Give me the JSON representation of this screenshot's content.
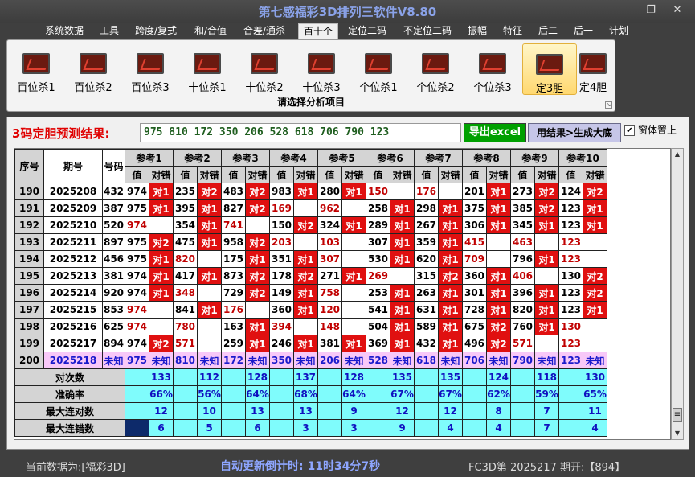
{
  "window": {
    "title": "第七感福彩3D排列三软件V8.80",
    "min": "—",
    "restore": "❐",
    "close": "✕"
  },
  "menu": [
    "系统数据",
    "工具",
    "跨度/复式",
    "和/合值",
    "合差/通杀",
    "百十个",
    "定位二码",
    "不定位二码",
    "振幅",
    "特征",
    "后二",
    "后一",
    "计划"
  ],
  "menu_active": "百十个",
  "ribbon": {
    "buttons": [
      "百位杀1",
      "百位杀2",
      "百位杀3",
      "十位杀1",
      "十位杀2",
      "十位杀3",
      "个位杀1",
      "个位杀2",
      "个位杀3",
      "定3胆",
      "定4胆"
    ],
    "selected": "定3胆",
    "caption": "请选择分析项目"
  },
  "prediction": {
    "label": "3码定胆预测结果:",
    "value": "975 810 172 350 206 528 618 706 790 123",
    "export_button": "导出excel",
    "generate_button": "用结果>生成大底",
    "topmost_label": "窗体置上",
    "topmost_checked": "✔"
  },
  "table": {
    "headers": {
      "index": "序号",
      "period": "期号",
      "number": "号码",
      "value": "值",
      "result": "对错"
    },
    "refs": [
      "参考1",
      "参考2",
      "参考3",
      "参考4",
      "参考5",
      "参考6",
      "参考7",
      "参考8",
      "参考9",
      "参考10"
    ],
    "rows": [
      {
        "idx": "190",
        "period": "2025208",
        "num": "432",
        "cells": [
          [
            "974",
            "对1"
          ],
          [
            "235",
            "对2"
          ],
          [
            "483",
            "对2"
          ],
          [
            "983",
            "对1"
          ],
          [
            "280",
            "对1"
          ],
          [
            "150",
            ""
          ],
          [
            "176",
            ""
          ],
          [
            "201",
            "对1"
          ],
          [
            "273",
            "对2"
          ],
          [
            "124",
            "对2"
          ]
        ]
      },
      {
        "idx": "191",
        "period": "2025209",
        "num": "387",
        "cells": [
          [
            "975",
            "对1"
          ],
          [
            "395",
            "对1"
          ],
          [
            "827",
            "对2"
          ],
          [
            "169",
            ""
          ],
          [
            "962",
            ""
          ],
          [
            "258",
            "对1"
          ],
          [
            "298",
            "对1"
          ],
          [
            "375",
            "对1"
          ],
          [
            "385",
            "对2"
          ],
          [
            "123",
            "对1"
          ]
        ]
      },
      {
        "idx": "192",
        "period": "2025210",
        "num": "520",
        "cells": [
          [
            "974",
            ""
          ],
          [
            "354",
            "对1"
          ],
          [
            "741",
            ""
          ],
          [
            "150",
            "对2"
          ],
          [
            "324",
            "对1"
          ],
          [
            "289",
            "对1"
          ],
          [
            "267",
            "对1"
          ],
          [
            "306",
            "对1"
          ],
          [
            "345",
            "对1"
          ],
          [
            "123",
            "对1"
          ]
        ]
      },
      {
        "idx": "193",
        "period": "2025211",
        "num": "897",
        "cells": [
          [
            "975",
            "对2"
          ],
          [
            "475",
            "对1"
          ],
          [
            "958",
            "对2"
          ],
          [
            "203",
            ""
          ],
          [
            "103",
            ""
          ],
          [
            "307",
            "对1"
          ],
          [
            "359",
            "对1"
          ],
          [
            "415",
            ""
          ],
          [
            "463",
            ""
          ],
          [
            "123",
            ""
          ]
        ]
      },
      {
        "idx": "194",
        "period": "2025212",
        "num": "456",
        "cells": [
          [
            "975",
            "对1"
          ],
          [
            "820",
            ""
          ],
          [
            "175",
            "对1"
          ],
          [
            "351",
            "对1"
          ],
          [
            "307",
            ""
          ],
          [
            "530",
            "对1"
          ],
          [
            "620",
            "对1"
          ],
          [
            "709",
            ""
          ],
          [
            "796",
            "对1"
          ],
          [
            "123",
            ""
          ]
        ]
      },
      {
        "idx": "195",
        "period": "2025213",
        "num": "381",
        "cells": [
          [
            "974",
            "对1"
          ],
          [
            "417",
            "对1"
          ],
          [
            "873",
            "对2"
          ],
          [
            "178",
            "对2"
          ],
          [
            "271",
            "对1"
          ],
          [
            "269",
            ""
          ],
          [
            "315",
            "对2"
          ],
          [
            "360",
            "对1"
          ],
          [
            "406",
            ""
          ],
          [
            "130",
            "对2"
          ]
        ]
      },
      {
        "idx": "196",
        "period": "2025214",
        "num": "920",
        "cells": [
          [
            "974",
            "对1"
          ],
          [
            "348",
            ""
          ],
          [
            "729",
            "对2"
          ],
          [
            "149",
            "对1"
          ],
          [
            "758",
            ""
          ],
          [
            "253",
            "对1"
          ],
          [
            "263",
            "对1"
          ],
          [
            "301",
            "对1"
          ],
          [
            "396",
            "对1"
          ],
          [
            "123",
            "对2"
          ]
        ]
      },
      {
        "idx": "197",
        "period": "2025215",
        "num": "853",
        "cells": [
          [
            "974",
            ""
          ],
          [
            "841",
            "对1"
          ],
          [
            "176",
            ""
          ],
          [
            "360",
            "对1"
          ],
          [
            "120",
            ""
          ],
          [
            "541",
            "对1"
          ],
          [
            "631",
            "对1"
          ],
          [
            "728",
            "对1"
          ],
          [
            "820",
            "对1"
          ],
          [
            "123",
            "对1"
          ]
        ]
      },
      {
        "idx": "198",
        "period": "2025216",
        "num": "625",
        "cells": [
          [
            "974",
            ""
          ],
          [
            "780",
            ""
          ],
          [
            "163",
            "对1"
          ],
          [
            "394",
            ""
          ],
          [
            "148",
            ""
          ],
          [
            "504",
            "对1"
          ],
          [
            "589",
            "对1"
          ],
          [
            "675",
            "对2"
          ],
          [
            "760",
            "对1"
          ],
          [
            "130",
            ""
          ]
        ]
      },
      {
        "idx": "199",
        "period": "2025217",
        "num": "894",
        "cells": [
          [
            "974",
            "对2"
          ],
          [
            "571",
            ""
          ],
          [
            "259",
            "对1"
          ],
          [
            "246",
            "对1"
          ],
          [
            "381",
            "对1"
          ],
          [
            "369",
            "对1"
          ],
          [
            "432",
            "对1"
          ],
          [
            "496",
            "对2"
          ],
          [
            "571",
            ""
          ],
          [
            "123",
            ""
          ]
        ]
      }
    ],
    "pending": {
      "idx": "200",
      "period": "2025218",
      "num": "未知",
      "cells": [
        [
          "975",
          "未知"
        ],
        [
          "810",
          "未知"
        ],
        [
          "172",
          "未知"
        ],
        [
          "350",
          "未知"
        ],
        [
          "206",
          "未知"
        ],
        [
          "528",
          "未知"
        ],
        [
          "618",
          "未知"
        ],
        [
          "706",
          "未知"
        ],
        [
          "790",
          "未知"
        ],
        [
          "123",
          "未知"
        ]
      ]
    },
    "stats": [
      {
        "label": "对次数",
        "values": [
          "133",
          "112",
          "128",
          "137",
          "128",
          "135",
          "135",
          "124",
          "118",
          "130"
        ]
      },
      {
        "label": "准确率",
        "values": [
          "66%",
          "56%",
          "64%",
          "68%",
          "64%",
          "67%",
          "67%",
          "62%",
          "59%",
          "65%"
        ]
      },
      {
        "label": "最大连对数",
        "values": [
          "12",
          "10",
          "13",
          "13",
          "9",
          "12",
          "12",
          "8",
          "7",
          "11"
        ]
      },
      {
        "label": "最大连错数",
        "values": [
          "6",
          "5",
          "6",
          "3",
          "3",
          "9",
          "4",
          "4",
          "7",
          "4"
        ]
      }
    ]
  },
  "status": {
    "source": "当前数据为:[福彩3D]",
    "countdown": "自动更新倒计时:  11时34分7秒",
    "issue": "FC3D第 2025217 期开:【894】"
  },
  "colors": {
    "hit": "#e01010",
    "pending": "#f8c8f8",
    "stat": "#7ffcfc",
    "accent": "#00a000"
  }
}
